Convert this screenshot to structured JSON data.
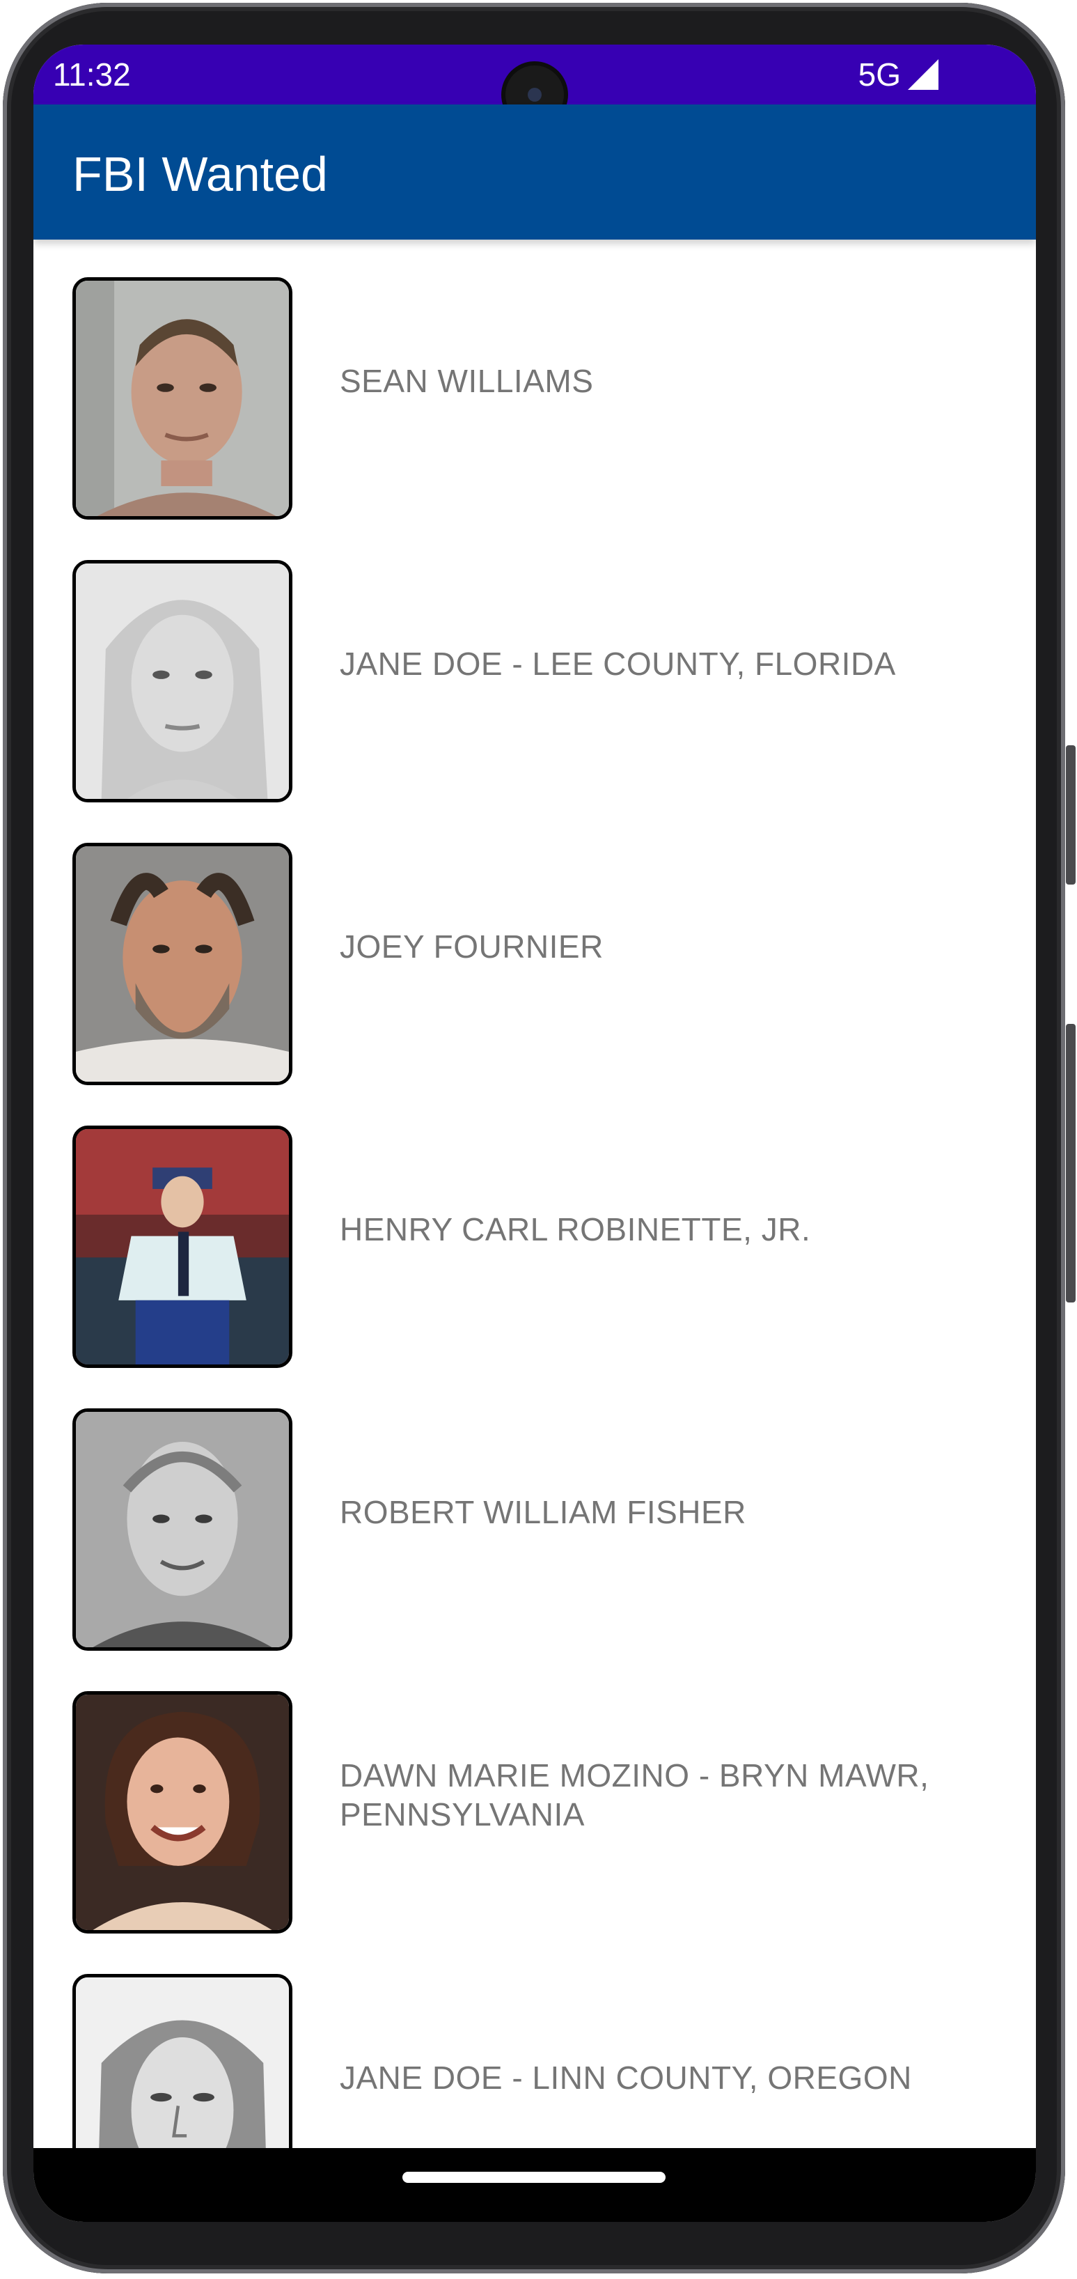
{
  "status_bar": {
    "time": "11:32",
    "network": "5G",
    "signal_icon": "signal-icon"
  },
  "app_bar": {
    "title": "FBI Wanted",
    "color": "#004b93"
  },
  "wanted_list": [
    {
      "name": "SEAN WILLIAMS",
      "photo": "mugshot-photo"
    },
    {
      "name": "JANE DOE - LEE COUNTY, FLORIDA",
      "photo": "mugshot-photo"
    },
    {
      "name": "JOEY FOURNIER",
      "photo": "mugshot-photo"
    },
    {
      "name": "HENRY CARL ROBINETTE, JR.",
      "photo": "photo"
    },
    {
      "name": "ROBERT WILLIAM FISHER",
      "photo": "photo"
    },
    {
      "name": "DAWN MARIE MOZINO - BRYN MAWR, PENNSYLVANIA",
      "photo": "photo"
    },
    {
      "name": "JANE DOE - LINN COUNTY, OREGON",
      "photo": "sketch"
    }
  ],
  "colors": {
    "status_bar": "#3700b3",
    "app_bar": "#004b93",
    "list_text": "#757575"
  }
}
